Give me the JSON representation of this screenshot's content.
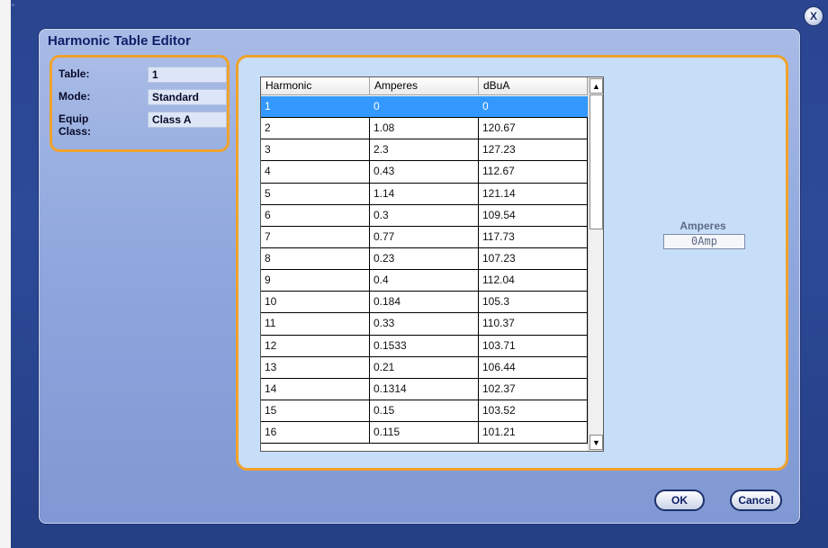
{
  "window": {
    "close_label": "X"
  },
  "dialog": {
    "title": "Harmonic Table Editor"
  },
  "info": {
    "table_label": "Table:",
    "table_value": "1",
    "mode_label": "Mode:",
    "mode_value": "Standard",
    "equip_label": "Equip Class:",
    "equip_value": "Class A"
  },
  "grid": {
    "headers": [
      "Harmonic",
      "Amperes",
      "dBuA"
    ],
    "rows": [
      [
        "1",
        "0",
        "0"
      ],
      [
        "2",
        "1.08",
        "120.67"
      ],
      [
        "3",
        "2.3",
        "127.23"
      ],
      [
        "4",
        "0.43",
        "112.67"
      ],
      [
        "5",
        "1.14",
        "121.14"
      ],
      [
        "6",
        "0.3",
        "109.54"
      ],
      [
        "7",
        "0.77",
        "117.73"
      ],
      [
        "8",
        "0.23",
        "107.23"
      ],
      [
        "9",
        "0.4",
        "112.04"
      ],
      [
        "10",
        "0.184",
        "105.3"
      ],
      [
        "11",
        "0.33",
        "110.37"
      ],
      [
        "12",
        "0.1533",
        "103.71"
      ],
      [
        "13",
        "0.21",
        "106.44"
      ],
      [
        "14",
        "0.1314",
        "102.37"
      ],
      [
        "15",
        "0.15",
        "103.52"
      ],
      [
        "16",
        "0.115",
        "101.21"
      ]
    ],
    "selected_row": 0,
    "scroll_up_icon": "▲",
    "scroll_down_icon": "▼"
  },
  "amperes": {
    "label": "Amperes",
    "value": "0Amp"
  },
  "buttons": {
    "ok": "OK",
    "cancel": "Cancel"
  },
  "colors": {
    "accent_border": "#f0a22c",
    "selection": "#3399ff",
    "title_text": "#0d1f66"
  }
}
